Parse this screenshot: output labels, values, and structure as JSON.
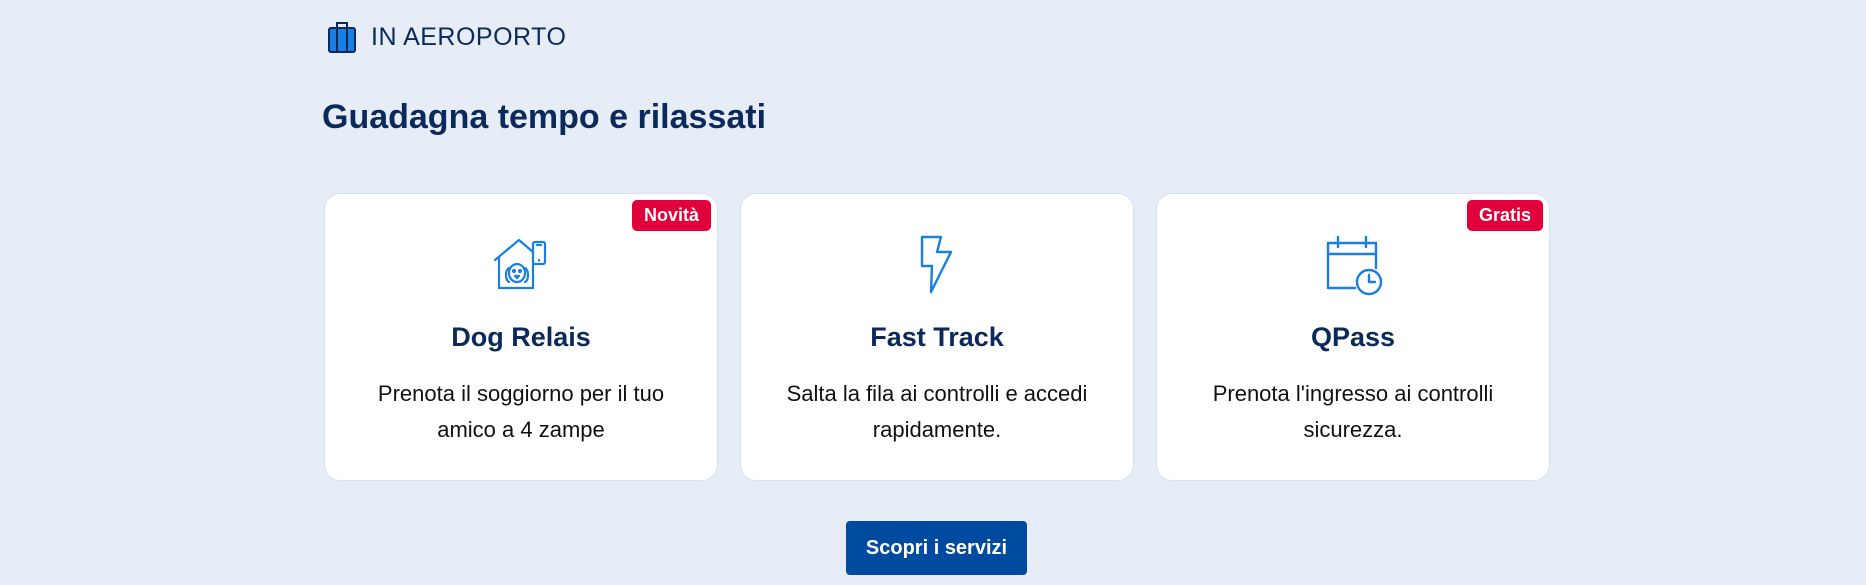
{
  "header": {
    "label": "IN AEROPORTO",
    "icon": "luggage-icon"
  },
  "title": "Guadagna tempo e rilassati",
  "cards": [
    {
      "badge": "Novità",
      "icon": "dog-house-icon",
      "title": "Dog Relais",
      "description": "Prenota il soggiorno per il tuo amico a 4 zampe"
    },
    {
      "icon": "lightning-icon",
      "title": "Fast Track",
      "description": "Salta la fila ai controlli e accedi rapidamente."
    },
    {
      "badge": "Gratis",
      "icon": "calendar-clock-icon",
      "title": "QPass",
      "description": "Prenota l'ingresso ai controlli sicurezza."
    }
  ],
  "cta": {
    "label": "Scopri i servizi"
  },
  "colors": {
    "background": "#e6edf6",
    "primary": "#004a9f",
    "heading": "#0b2a5b",
    "badge": "#e0003c",
    "icon": "#1a7fe0"
  }
}
